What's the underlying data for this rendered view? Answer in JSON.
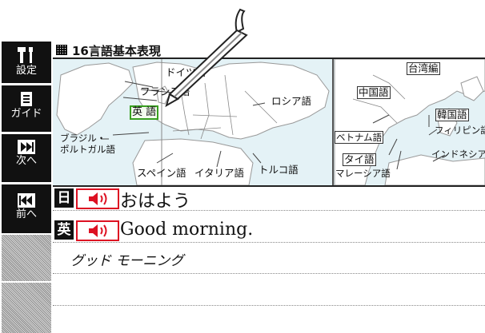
{
  "sidebar": {
    "items": [
      {
        "label": "設定",
        "icon": "wrench-screwdriver-icon"
      },
      {
        "label": "ガイド",
        "icon": "document-icon"
      },
      {
        "label": "次へ",
        "icon": "next-track-icon"
      },
      {
        "label": "前へ",
        "icon": "previous-track-icon"
      }
    ]
  },
  "header": {
    "title": "16言語基本表現"
  },
  "map": {
    "europe": {
      "labels": {
        "german": "ドイツ語",
        "french": "フランス語",
        "english": "英 語",
        "russian": "ロシア語",
        "portuguese_line1": "ブラジル・",
        "portuguese_line2": "ポルトガル語",
        "spanish": "スペイン語",
        "italian": "イタリア語",
        "turkish": "トルコ語"
      }
    },
    "asia": {
      "labels": {
        "taiwan": "台湾編",
        "chinese": "中国語",
        "korean": "韓国語",
        "filipino": "フィリピン語",
        "vietnamese": "ベトナム語",
        "thai": "タイ語",
        "indonesian": "インドネシア語",
        "malay": "マレーシア語"
      }
    },
    "colors": {
      "sea": "#e4f2f6",
      "land": "#ffffff",
      "selected": "#39a020"
    }
  },
  "phrases": [
    {
      "lang_tag": "日",
      "text": "おはよう",
      "speaker_icon": "speaker-icon"
    },
    {
      "lang_tag": "英",
      "text": "Good morning.",
      "speaker_icon": "speaker-icon"
    }
  ],
  "pronunciation": "グッド モーニング",
  "colors": {
    "speaker_border": "#dd1122",
    "bar": "#111111"
  }
}
